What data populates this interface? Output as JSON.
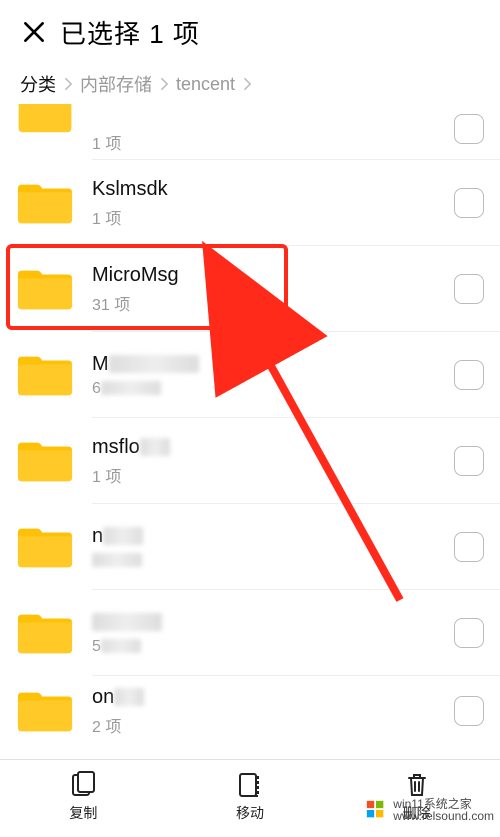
{
  "header": {
    "title": "已选择 1 项"
  },
  "breadcrumb": {
    "seg0": "分类",
    "seg1": "内部存储",
    "seg2": "tencent"
  },
  "rows": {
    "r0": {
      "sub": "1 项"
    },
    "r1": {
      "name": "Kslmsdk",
      "sub": "1 项"
    },
    "r2": {
      "name": "MicroMsg",
      "sub": "31 项"
    },
    "r3": {
      "name_prefix": "M",
      "sub_prefix": "6"
    },
    "r4": {
      "name_prefix": "msflo",
      "sub": "1 项"
    },
    "r5": {
      "name_prefix": "n"
    },
    "r6": {
      "sub_prefix": "5"
    },
    "r7": {
      "name_prefix": "on",
      "sub": "2 项"
    }
  },
  "actions": {
    "copy": "复制",
    "move": "移动",
    "delete": "删除"
  },
  "watermark": {
    "line1": "win11系统之家",
    "line2": "www.relsound.com"
  },
  "colors": {
    "folder": "#ffc107",
    "highlight": "#ff2a1a"
  }
}
